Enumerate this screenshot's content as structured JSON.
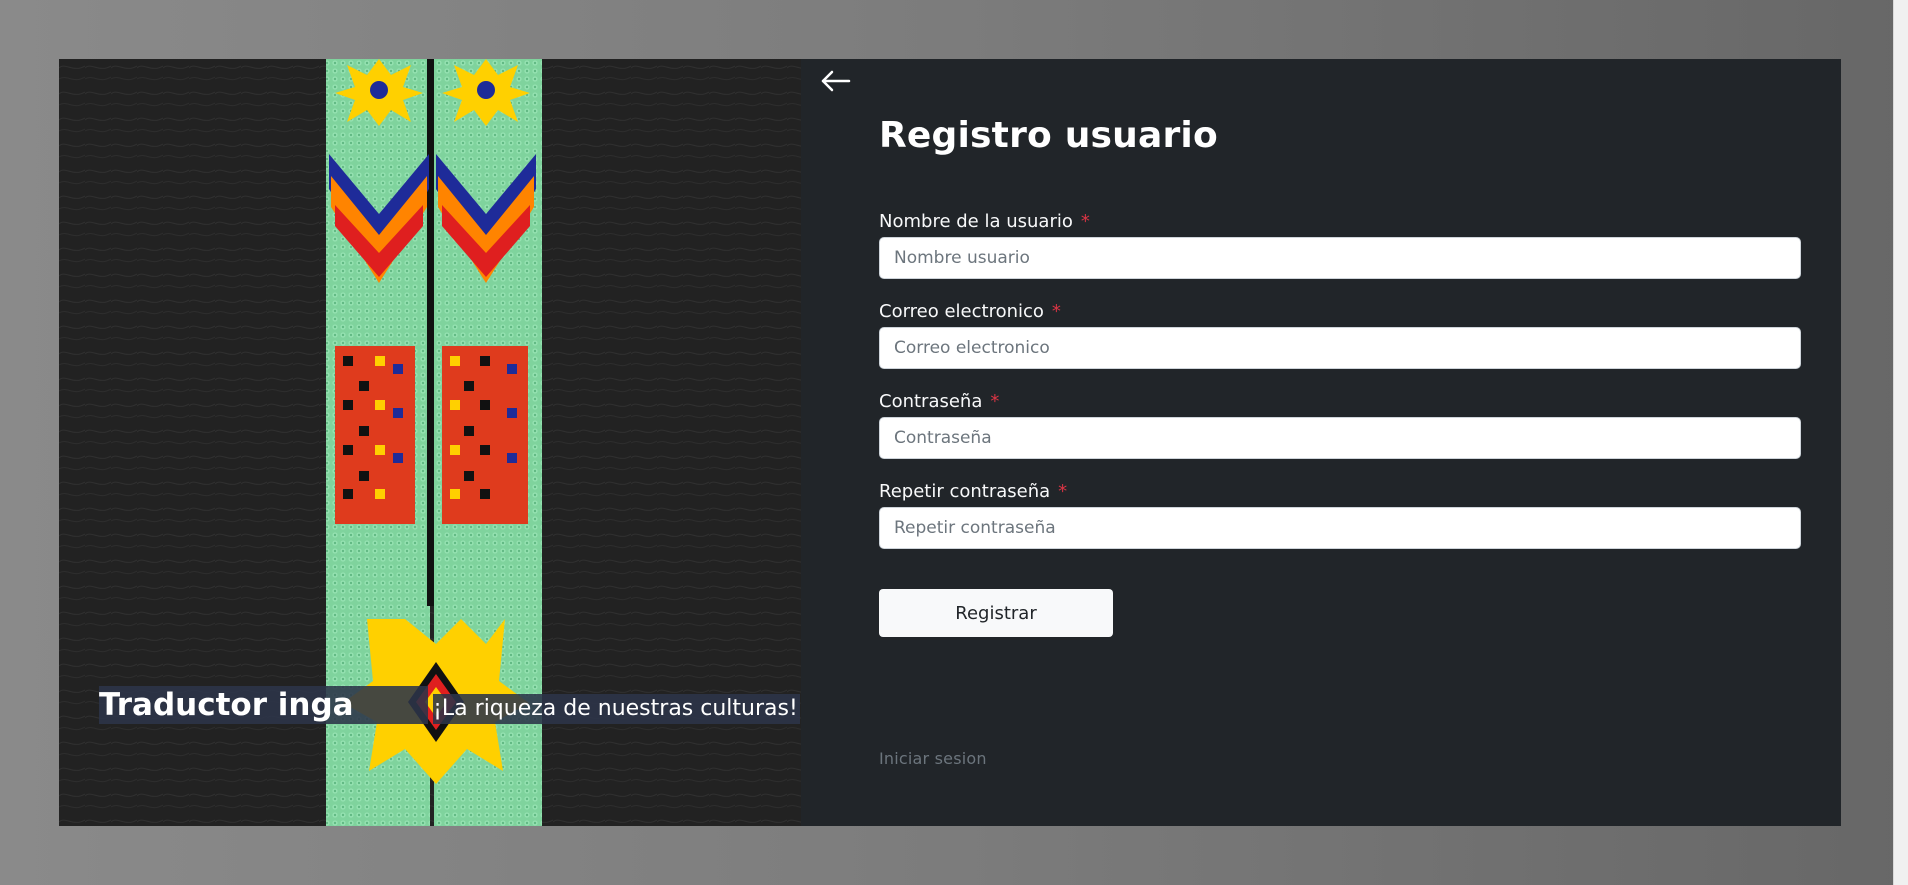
{
  "hero": {
    "title": "Traductor inga",
    "subtitle": "¡La riqueza de nuestras culturas!"
  },
  "header": {
    "back_icon": "arrow-left-icon",
    "title": "Registro usuario"
  },
  "form": {
    "required_mark": "*",
    "fields": [
      {
        "label": "Nombre de la usuario",
        "placeholder": "Nombre usuario"
      },
      {
        "label": "Correo electronico",
        "placeholder": "Correo electronico"
      },
      {
        "label": "Contraseña",
        "placeholder": "Contraseña"
      },
      {
        "label": "Repetir contraseña",
        "placeholder": "Repetir contraseña"
      }
    ],
    "submit_label": "Registrar",
    "login_link": "Iniciar sesion"
  },
  "colors": {
    "panel_bg": "#212529",
    "input_bg": "#ffffff",
    "required": "#dc3545",
    "button_bg": "#f8f9fa",
    "muted_link": "#6c757d"
  }
}
